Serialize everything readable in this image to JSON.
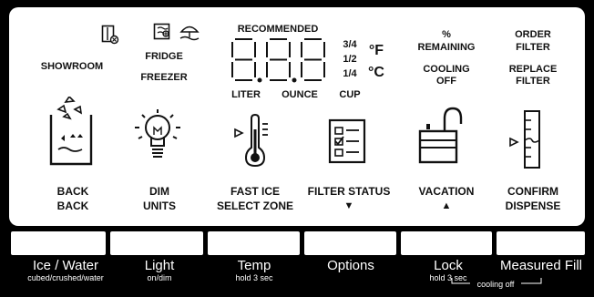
{
  "status_labels": {
    "showroom": "SHOWROOM",
    "fridge": "FRIDGE",
    "freezer": "FREEZER",
    "recommended": "RECOMMENDED",
    "fraction_3_4": "3/4",
    "fraction_1_2": "1/2",
    "fraction_1_4": "1/4",
    "unit_f": "°F",
    "unit_c": "°C",
    "liter": "LITER",
    "ounce": "OUNCE",
    "cup": "CUP",
    "percent": "%",
    "remaining": "REMAINING",
    "cooling": "COOLING",
    "off": "OFF",
    "order": "ORDER",
    "filter1": "FILTER",
    "replace": "REPLACE",
    "filter2": "FILTER"
  },
  "display_digits": "8.8.8",
  "icon_labels": {
    "back1": "BACK",
    "back2": "BACK",
    "dim": "DIM",
    "units": "UNITS",
    "fast_ice": "FAST ICE",
    "select_zone": "SELECT ZONE",
    "filter_status": "FILTER STATUS",
    "down_arrow": "▼",
    "vacation": "VACATION",
    "up_arrow": "▲",
    "confirm": "CONFIRM",
    "dispense": "DISPENSE"
  },
  "buttons": [
    {
      "label": "Ice / Water",
      "sub": "cubed/crushed/water"
    },
    {
      "label": "Light",
      "sub": "on/dim"
    },
    {
      "label": "Temp",
      "sub": "hold 3 sec"
    },
    {
      "label": "Options",
      "sub": ""
    },
    {
      "label": "Lock",
      "sub": "hold 3 sec"
    },
    {
      "label": "Measured Fill",
      "sub": ""
    }
  ],
  "cooling_off_bracket_label": "cooling off"
}
